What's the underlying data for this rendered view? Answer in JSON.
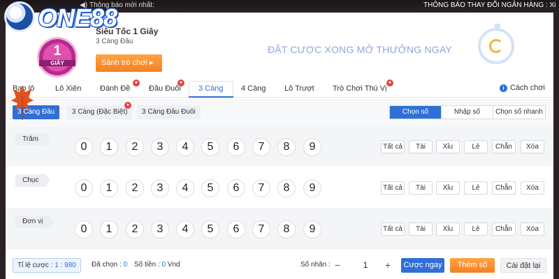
{
  "topbar": {
    "notice_label": "Thông báo mới nhất:",
    "marquee": "THÔNG BÁO THAY ĐỔI NGÂN HÀNG :    Xi"
  },
  "logo": {
    "brand": "ONE88"
  },
  "game": {
    "badge_number": "1",
    "badge_unit": "GIÂY",
    "title": "Siêu Tốc 1 Giây",
    "subtitle": "3 Càng Đầu",
    "lobby_button": "Sảnh trò chơi ▸",
    "slogan": "ĐẶT CƯỢC XONG MỞ THƯỞNG NGAY"
  },
  "tabs": [
    {
      "label": "Bao lô"
    },
    {
      "label": "Lô Xiên"
    },
    {
      "label": "Đánh Đề"
    },
    {
      "label": "Đầu Đuôi"
    },
    {
      "label": "3 Càng",
      "active": true
    },
    {
      "label": "4 Càng"
    },
    {
      "label": "Lô Trượt"
    },
    {
      "label": "Trò Chơi Thú Vị"
    }
  ],
  "help": {
    "label": "Cách chơi",
    "icon": "info-icon"
  },
  "subtabs": [
    {
      "label": "3 Càng Đầu",
      "active": true
    },
    {
      "label": "3 Càng (Đặc Biệt)"
    },
    {
      "label": "3 Càng Đầu Đuôi"
    }
  ],
  "modes": [
    {
      "label": "Chọn số",
      "active": true
    },
    {
      "label": "Nhập số"
    },
    {
      "label": "Chọn số nhanh"
    }
  ],
  "rows": [
    {
      "label": "Trăm"
    },
    {
      "label": "Chục"
    },
    {
      "label": "Đơn vị"
    }
  ],
  "digits": [
    "0",
    "1",
    "2",
    "3",
    "4",
    "5",
    "6",
    "7",
    "8",
    "9"
  ],
  "quick_picks": [
    "Tất cả",
    "Tài",
    "Xỉu",
    "Lẻ",
    "Chẵn",
    "Xóa"
  ],
  "footer": {
    "ratio_label": "Tỉ lệ cược : ",
    "ratio_value": "1 : 980",
    "chosen_label": "Đã chọn : ",
    "chosen_value": "0",
    "amount_label": "Số tiền : ",
    "amount_value": "0",
    "amount_unit": " Vnd",
    "multiplier_label": "Số nhân :",
    "multiplier_value": "1",
    "minus": "−",
    "plus": "+",
    "bet_button": "Cược ngay",
    "add_button": "Thêm số",
    "reset_button": "Cài đặt lại"
  },
  "colors": {
    "accent": "#2f6fd6",
    "orange": "#f4811f",
    "hot": "#e84343"
  }
}
